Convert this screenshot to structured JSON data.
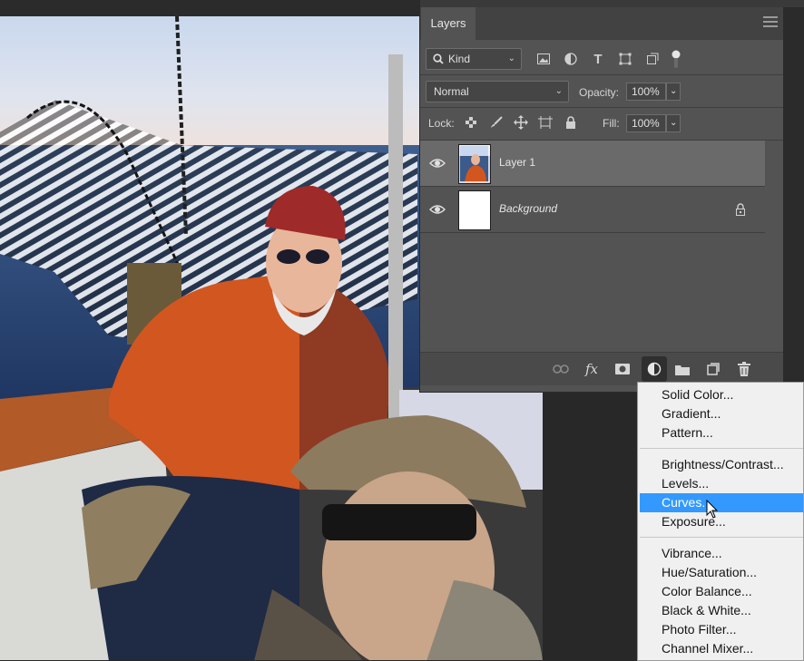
{
  "panel": {
    "tab_label": "Layers",
    "filter": {
      "kind_label": "Kind"
    },
    "blend_mode": "Normal",
    "opacity_label": "Opacity:",
    "opacity_value": "100%",
    "lock_label": "Lock:",
    "fill_label": "Fill:",
    "fill_value": "100%"
  },
  "layers": [
    {
      "name": "Layer 1",
      "selected": true,
      "visible": true
    },
    {
      "name": "Background",
      "selected": false,
      "visible": true,
      "locked": true,
      "italic": true
    }
  ],
  "menu": {
    "groups": [
      [
        "Solid Color...",
        "Gradient...",
        "Pattern..."
      ],
      [
        "Brightness/Contrast...",
        "Levels...",
        "Curves...",
        "Exposure..."
      ],
      [
        "Vibrance...",
        "Hue/Saturation...",
        "Color Balance...",
        "Black & White...",
        "Photo Filter...",
        "Channel Mixer..."
      ]
    ],
    "highlighted": "Curves...",
    "items": {
      "solid_color": "Solid Color...",
      "gradient": "Gradient...",
      "pattern": "Pattern...",
      "brightness_contrast": "Brightness/Contrast...",
      "levels": "Levels...",
      "curves": "Curves...",
      "exposure": "Exposure...",
      "vibrance": "Vibrance...",
      "hue_saturation": "Hue/Saturation...",
      "color_balance": "Color Balance...",
      "black_white": "Black & White...",
      "photo_filter": "Photo Filter...",
      "channel_mixer": "Channel Mixer..."
    }
  },
  "colors": {
    "panel_bg": "#535353",
    "selected_layer": "#6a6a6a",
    "menu_highlight": "#3399ff",
    "menu_bg": "#f0f0f0"
  },
  "icons": [
    "search-icon",
    "image-filter-icon",
    "adjustment-filter-icon",
    "type-filter-icon",
    "shape-filter-icon",
    "smart-object-filter-icon",
    "filter-toggle-icon",
    "lock-transparent-icon",
    "lock-paint-icon",
    "lock-move-icon",
    "lock-artboard-icon",
    "lock-all-icon",
    "eye-icon",
    "lock-icon",
    "link-icon",
    "fx-icon",
    "mask-icon",
    "adjustment-layer-icon",
    "group-folder-icon",
    "new-layer-icon",
    "trash-icon",
    "panel-menu-icon",
    "cursor-arrow-icon"
  ]
}
